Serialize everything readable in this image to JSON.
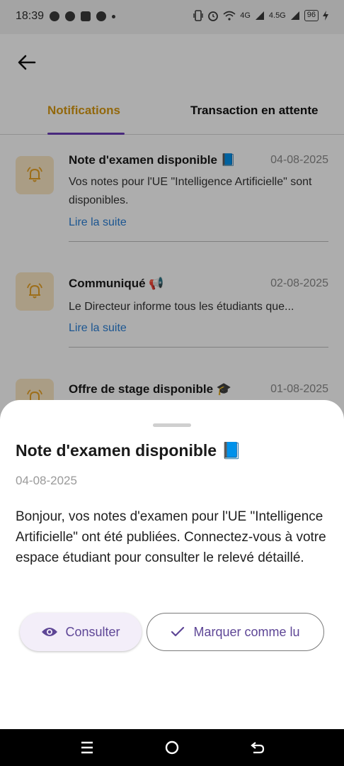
{
  "status_bar": {
    "time": "18:39",
    "network_1": "4G",
    "network_2": "4.5G",
    "battery": "96",
    "icons": [
      "messenger-icon",
      "chat-icon",
      "game-icon",
      "whatsapp-icon",
      "vibrate-icon",
      "alarm-icon",
      "wifi-icon",
      "signal-icon",
      "battery-icon",
      "charging-icon"
    ]
  },
  "header": {
    "back_icon": "arrow-left-icon"
  },
  "tabs": [
    {
      "label": "Notifications",
      "active": true
    },
    {
      "label": "Transaction en attente",
      "active": false
    }
  ],
  "colors": {
    "active_tab": "#d89a14",
    "indicator": "#6a3db8",
    "link": "#2a7fd6",
    "bell_bg": "#fbe7c4",
    "bell": "#e8a326",
    "button_text": "#5e4696"
  },
  "notifications": [
    {
      "title": "Note d'examen disponible 📘",
      "date": "04-08-2025",
      "body": "Vos notes pour l'UE \"Intelligence Artificielle\" sont disponibles.",
      "link": "Lire la suite"
    },
    {
      "title": "Communiqué 📢",
      "date": "02-08-2025",
      "body": "Le Directeur informe tous les étudiants que...",
      "link": "Lire la suite"
    },
    {
      "title": "Offre de stage disponible 🎓",
      "date": "01-08-2025"
    }
  ],
  "sheet": {
    "title": "Note d'examen disponible 📘",
    "date": "04-08-2025",
    "body": "Bonjour, vos notes d'examen pour l'UE \"Intelligence Artificielle\" ont été publiées. Connectez-vous à votre espace étudiant pour consulter le relevé détaillé.",
    "consult_label": "Consulter",
    "mark_read_label": "Marquer comme lu"
  },
  "nav": {
    "icons": [
      "menu-icon",
      "home-icon",
      "back-icon"
    ]
  }
}
